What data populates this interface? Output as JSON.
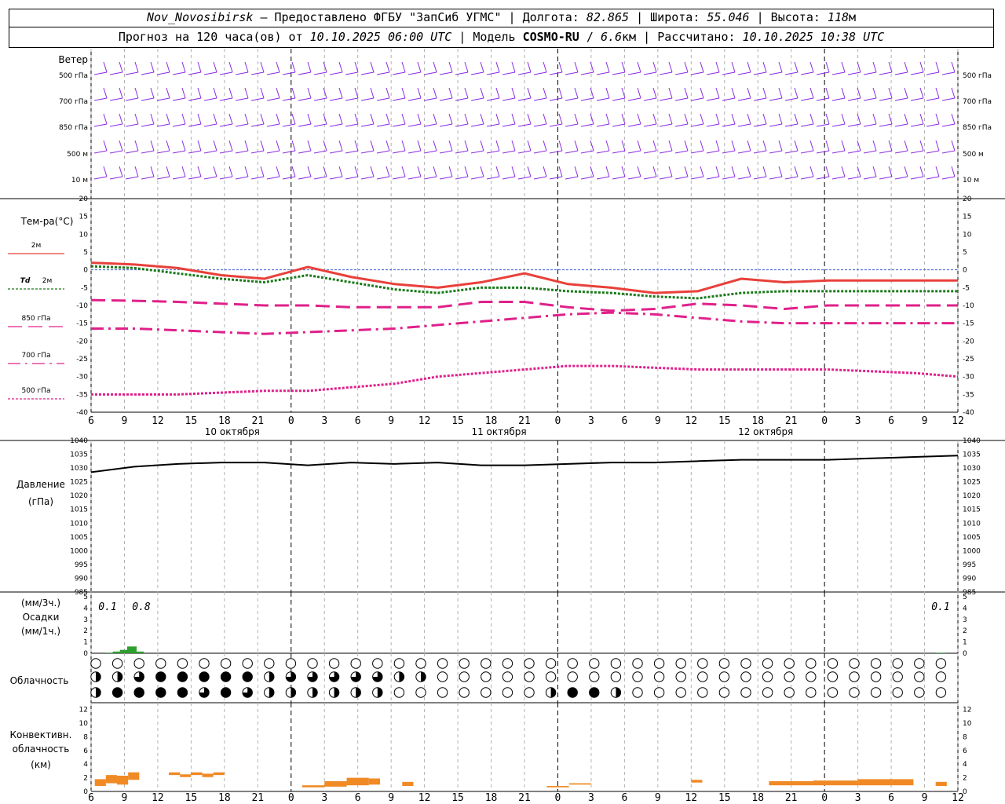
{
  "header": {
    "station": "Nov_Novosibirsk",
    "provider_text": "– Предоставлено ФГБУ \"ЗапСиб УГМС\"",
    "lon_label": "Долгота:",
    "lon_value": "82.865",
    "lat_label": "Широта:",
    "lat_value": "55.046",
    "alt_label": "Высота:",
    "alt_value": "118",
    "alt_unit": "м",
    "forecast_label": "Прогноз на 120 часа(ов) от",
    "forecast_start": "10.10.2025 06:00 UTC",
    "model_label": "Модель",
    "model_name": "COSMO-RU",
    "model_res": "6.6",
    "model_res_unit": "км",
    "calc_label": "Рассчитано:",
    "calc_time": "10.10.2025 10:38 UTC"
  },
  "chart_data": [
    {
      "type": "wind_barbs",
      "title": "Ветер",
      "levels": [
        "500 гПа",
        "700 гПа",
        "850 гПа",
        "500 м",
        "10 м"
      ],
      "levels_right": [
        "500 гПа",
        "700 гПа",
        "850 гПа",
        "500 м",
        "10 м"
      ],
      "color": "#8a2be2"
    },
    {
      "type": "line",
      "title": "Тем-ра(°C)",
      "ylim": [
        -40,
        20
      ],
      "yticks": [
        "20",
        "15",
        "10",
        "5",
        "0",
        "-5",
        "-10",
        "-15",
        "-20",
        "-25",
        "-30",
        "-35",
        "-40"
      ],
      "x_hours": [
        0,
        6,
        12,
        18,
        24,
        30,
        36,
        42,
        48,
        54,
        60,
        66,
        72,
        78,
        84,
        90,
        96,
        102,
        108,
        114,
        120
      ],
      "series": [
        {
          "name": "2м",
          "color": "#e8403a",
          "dash": "solid",
          "values": [
            2,
            1.5,
            0.5,
            -1.5,
            -2.5,
            0.8,
            -2,
            -4,
            -5,
            -3.5,
            -1,
            -4,
            -5,
            -6.5,
            -6,
            -2.5,
            -3.5,
            -3,
            -3,
            -3,
            -3
          ]
        },
        {
          "name": "Td 2м",
          "name_prefix": "Td",
          "name_suffix": "2м",
          "color": "#1a7a1a",
          "dash": "dotted",
          "values": [
            1,
            0.5,
            -1,
            -2.5,
            -3.5,
            -1.5,
            -3.5,
            -5.5,
            -6.5,
            -5,
            -5,
            -6,
            -6.5,
            -7.5,
            -8,
            -6.5,
            -6,
            -6,
            -6,
            -6,
            -6
          ]
        },
        {
          "name": "850 гПа",
          "color": "#e0208a",
          "dash": "longdash",
          "values": [
            -8.5,
            -8.7,
            -9,
            -9.5,
            -10,
            -10,
            -10.5,
            -10.5,
            -10.5,
            -9,
            -9,
            -10.5,
            -11.5,
            -11,
            -9.5,
            -10,
            -11,
            -10,
            -10,
            -10,
            -10
          ]
        },
        {
          "name": "700 гПа",
          "color": "#e0208a",
          "dash": "dashdot",
          "values": [
            -16.5,
            -16.5,
            -17,
            -17.5,
            -18,
            -17.5,
            -17,
            -16.5,
            -15.5,
            -14.5,
            -13.5,
            -12.5,
            -12,
            -12.5,
            -13.5,
            -14.5,
            -15,
            -15,
            -15,
            -15,
            -15
          ]
        },
        {
          "name": "500 гПа",
          "color": "#e0208a",
          "dash": "fine",
          "values": [
            -35,
            -35,
            -35,
            -34.5,
            -34,
            -34,
            -33,
            -32,
            -30,
            -29,
            -28,
            -27,
            -27,
            -27.5,
            -28,
            -28,
            -28,
            -28,
            -28.5,
            -29,
            -30
          ]
        }
      ]
    },
    {
      "type": "line",
      "title": "Давление (гПа)",
      "ylim": [
        985,
        1040
      ],
      "yticks": [
        "1040",
        "1035",
        "1030",
        "1025",
        "1020",
        "1015",
        "1010",
        "1005",
        "1000",
        "995",
        "990",
        "985"
      ],
      "series": [
        {
          "color": "#000000",
          "values": [
            1028.5,
            1030.5,
            1031.5,
            1032,
            1032,
            1031,
            1032,
            1031.5,
            1032,
            1031,
            1031,
            1031.5,
            1032,
            1032,
            1032.5,
            1033,
            1033,
            1033,
            1033.5,
            1034,
            1034.5
          ]
        }
      ]
    },
    {
      "type": "bar",
      "title": "Осадки",
      "unit_top": "(мм/3ч.)",
      "unit_bottom": "(мм/1ч.)",
      "ylim": [
        0,
        5
      ],
      "yticks": [
        "5",
        "4",
        "3",
        "2",
        "1",
        "0"
      ],
      "annotations": [
        "0.1",
        "0.8",
        "0.1"
      ],
      "bars": [
        {
          "hour": 2,
          "value": 0.05,
          "color": "#2e9e2e"
        },
        {
          "hour": 3,
          "value": 0.15,
          "color": "#2e9e2e"
        },
        {
          "hour": 4,
          "value": 0.3,
          "color": "#2e9e2e"
        },
        {
          "hour": 5,
          "value": 0.6,
          "color": "#2e9e2e"
        },
        {
          "hour": 6,
          "value": 0.15,
          "color": "#2e9e2e"
        },
        {
          "hour": 117,
          "value": 0.05,
          "color": "#2e9e2e"
        }
      ]
    },
    {
      "type": "cloud_symbols",
      "title": "Облачность",
      "note": "three rows of cloud-cover circles every 3 hours (0 = clear, 4 = overcast)",
      "rows": [
        [
          0,
          0,
          0,
          0,
          0,
          0,
          0,
          0,
          0,
          0,
          0,
          0,
          0,
          0,
          0,
          0,
          0,
          0,
          0,
          0,
          0,
          0,
          0,
          0,
          0,
          0,
          0,
          0,
          0,
          0,
          0,
          0,
          0,
          0,
          0,
          0,
          0,
          0,
          0,
          0,
          0
        ],
        [
          2,
          2,
          3,
          4,
          4,
          4,
          4,
          4,
          2,
          3,
          3,
          3,
          3,
          3,
          2,
          2,
          0,
          0,
          0,
          0,
          0,
          0,
          0,
          0,
          0,
          0,
          0,
          0,
          0,
          0,
          0,
          0,
          0,
          0,
          0,
          0,
          0,
          0,
          0,
          0,
          0
        ],
        [
          2,
          4,
          4,
          4,
          4,
          3,
          4,
          3,
          2,
          2,
          2,
          2,
          2,
          2,
          0,
          0,
          0,
          0,
          0,
          0,
          0,
          2,
          4,
          4,
          2,
          0,
          0,
          0,
          0,
          0,
          0,
          0,
          0,
          0,
          0,
          0,
          0,
          0,
          0,
          0,
          0
        ]
      ]
    },
    {
      "type": "bar",
      "title": "Конвективн. облачность (км)",
      "ylim": [
        0,
        13
      ],
      "yticks": [
        "12",
        "10",
        "8",
        "6",
        "4",
        "2",
        "0"
      ],
      "color": "#f08a24",
      "segments": [
        {
          "h0": 1,
          "h1": 4,
          "top": 1.8,
          "bottom": 0.8
        },
        {
          "h0": 4,
          "h1": 7,
          "top": 2.4,
          "bottom": 1.2
        },
        {
          "h0": 7,
          "h1": 10,
          "top": 2.3,
          "bottom": 1.0
        },
        {
          "h0": 10,
          "h1": 13,
          "top": 2.8,
          "bottom": 1.7
        },
        {
          "h0": 21,
          "h1": 24,
          "top": 2.8,
          "bottom": 2.4
        },
        {
          "h0": 24,
          "h1": 27,
          "top": 2.5,
          "bottom": 2.1
        },
        {
          "h0": 27,
          "h1": 30,
          "top": 2.8,
          "bottom": 2.4
        },
        {
          "h0": 30,
          "h1": 33,
          "top": 2.6,
          "bottom": 2.1
        },
        {
          "h0": 33,
          "h1": 36,
          "top": 2.8,
          "bottom": 2.4
        },
        {
          "h0": 57,
          "h1": 63,
          "top": 0.9,
          "bottom": 0.6
        },
        {
          "h0": 63,
          "h1": 69,
          "top": 1.5,
          "bottom": 0.7
        },
        {
          "h0": 69,
          "h1": 75,
          "top": 2.0,
          "bottom": 0.9
        },
        {
          "h0": 75,
          "h1": 78,
          "top": 1.9,
          "bottom": 1.0
        },
        {
          "h0": 84,
          "h1": 87,
          "top": 1.4,
          "bottom": 0.8
        },
        {
          "h0": 123,
          "h1": 129,
          "top": 0.8,
          "bottom": 0.6
        },
        {
          "h0": 129,
          "h1": 135,
          "top": 1.2,
          "bottom": 1.0
        },
        {
          "h0": 162,
          "h1": 165,
          "top": 1.7,
          "bottom": 1.3
        },
        {
          "h0": 183,
          "h1": 195,
          "top": 1.5,
          "bottom": 0.9
        },
        {
          "h0": 195,
          "h1": 207,
          "top": 1.6,
          "bottom": 0.9
        },
        {
          "h0": 207,
          "h1": 216,
          "top": 1.8,
          "bottom": 0.9
        },
        {
          "h0": 216,
          "h1": 222,
          "top": 1.8,
          "bottom": 0.9
        },
        {
          "h0": 228,
          "h1": 231,
          "top": 1.4,
          "bottom": 0.8
        }
      ]
    }
  ],
  "x_axis": {
    "hours_label": [
      "6",
      "9",
      "12",
      "15",
      "18",
      "21",
      "0",
      "3",
      "6",
      "9",
      "12",
      "15",
      "18",
      "21",
      "0",
      "3",
      "6",
      "9",
      "12",
      "15",
      "18",
      "21",
      "0",
      "3",
      "6",
      "9",
      "12"
    ],
    "dates": [
      "10 октября",
      "11 октября",
      "12 октября"
    ]
  }
}
